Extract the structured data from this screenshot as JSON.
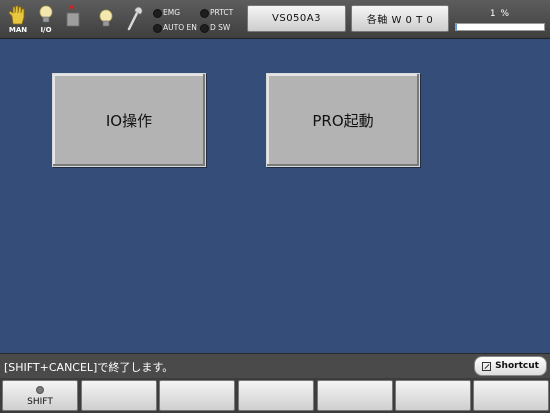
{
  "status_bar": {
    "mode_label": "MAN",
    "io_label": "I/O",
    "indicators": [
      {
        "label": "EMG"
      },
      {
        "label": "PRTCT"
      },
      {
        "label": "AUTO EN"
      },
      {
        "label": "D SW"
      }
    ],
    "model_button": "VS050A3",
    "axis_button": "各軸 W 0 T 0",
    "speed_text": "1 %",
    "speed_percent": 1
  },
  "main": {
    "io_button": "IO操作",
    "pro_button": "PRO起動"
  },
  "message_bar": {
    "text": "[SHIFT+CANCEL]で終了します。",
    "shortcut_label": "Shortcut"
  },
  "function_keys": [
    {
      "label": "SHIFT"
    },
    {
      "label": ""
    },
    {
      "label": ""
    },
    {
      "label": ""
    },
    {
      "label": ""
    },
    {
      "label": ""
    },
    {
      "label": ""
    }
  ],
  "colors": {
    "background": "#354d79",
    "top_bar": "#4d4d4d",
    "main_button": "#b3b3b3",
    "status_icon_yellow": "#e8c640",
    "record_red": "#d42020"
  }
}
